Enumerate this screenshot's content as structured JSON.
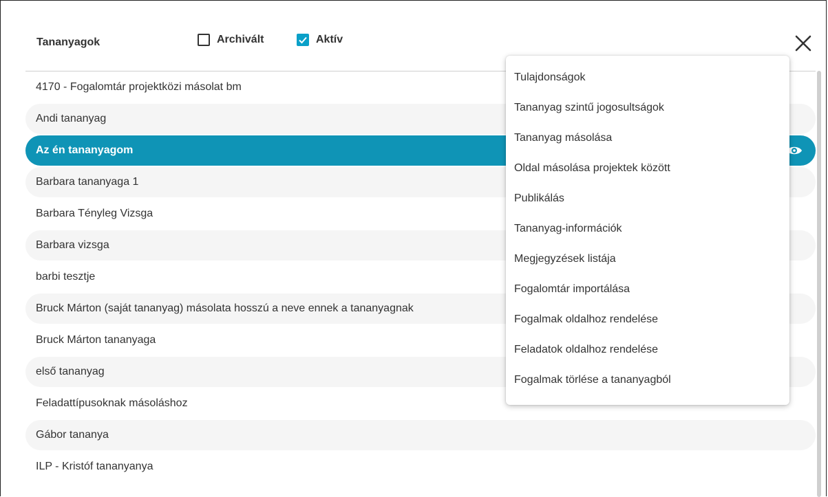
{
  "header": {
    "title": "Tananyagok",
    "filters": {
      "archived_label": "Archivált",
      "archived_checked": false,
      "active_label": "Aktív",
      "active_checked": true
    },
    "close_icon": "close-icon"
  },
  "list": {
    "items": [
      {
        "label": "4170 - Fogalomtár projektközi másolat bm"
      },
      {
        "label": "Andi tananyag"
      },
      {
        "label": "Az én tananyagom",
        "selected": true
      },
      {
        "label": "Barbara tananyaga 1"
      },
      {
        "label": "Barbara Tényleg Vizsga"
      },
      {
        "label": "Barbara vizsga"
      },
      {
        "label": "barbi tesztje"
      },
      {
        "label": "Bruck Márton (saját tananyag) másolata hosszú a neve ennek a tananyagnak"
      },
      {
        "label": "Bruck Márton tananyaga"
      },
      {
        "label": "első tananyag"
      },
      {
        "label": "Feladattípusoknak másoláshoz"
      },
      {
        "label": "Gábor tananya"
      },
      {
        "label": "ILP - Kristóf tananyanya"
      }
    ]
  },
  "context_menu": {
    "items": [
      {
        "label": "Tulajdonságok"
      },
      {
        "label": "Tananyag szintű jogosultságok"
      },
      {
        "label": "Tananyag másolása"
      },
      {
        "label": "Oldal másolása projektek között"
      },
      {
        "label": "Publikálás"
      },
      {
        "label": "Tananyag-információk"
      },
      {
        "label": "Megjegyzések listája"
      },
      {
        "label": "Fogalomtár importálása"
      },
      {
        "label": "Fogalmak oldalhoz rendelése"
      },
      {
        "label": "Feladatok oldalhoz rendelése"
      },
      {
        "label": "Fogalmak törlése a tananyagból"
      }
    ]
  },
  "colors": {
    "accent": "#0f94b6",
    "checkbox_accent": "#0aa0c8",
    "row_alt": "#f5f5f5"
  }
}
